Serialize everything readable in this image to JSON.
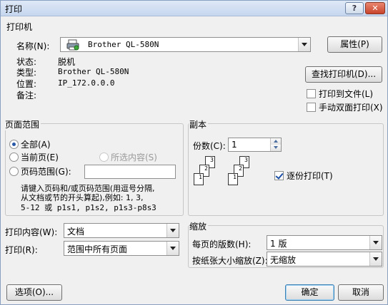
{
  "window": {
    "title": "打印",
    "help_label": "?",
    "close_label": "✕"
  },
  "printer": {
    "section_title": "打印机",
    "name_label": "名称(N):",
    "name_value": "Brother QL-580N",
    "status_label": "状态:",
    "status_value": "脱机",
    "type_label": "类型:",
    "type_value": "Brother QL-580N",
    "location_label": "位置:",
    "location_value": "IP_172.0.0.0",
    "comment_label": "备注:",
    "properties_button": "属性(P)",
    "find_printer_button": "查找打印机(D)...",
    "print_to_file_label": "打印到文件(L)",
    "print_to_file_checked": false,
    "manual_duplex_label": "手动双面打印(X)",
    "manual_duplex_checked": false,
    "printer_icon": "printer-icon"
  },
  "page_range": {
    "section_title": "页面范围",
    "all_label": "全部(A)",
    "current_page_label": "当前页(E)",
    "selection_label": "所选内容(S)",
    "pages_label": "页码范围(G):",
    "pages_value": "",
    "hint_line1": "请键入页码和/或页码范围(用逗号分隔,",
    "hint_line2": "从文档或节的开头算起),例如: 1, 3,",
    "hint_line3": "5-12 或 p1s1, p1s2, p1s3-p8s3",
    "selected": "all"
  },
  "copies": {
    "section_title": "副本",
    "count_label": "份数(C):",
    "count_value": "1",
    "collate_label": "逐份打印(T)",
    "collate_checked": true,
    "stack_pages": [
      "3",
      "2",
      "1"
    ]
  },
  "print_what": {
    "label": "打印内容(W):",
    "value": "文档"
  },
  "print": {
    "label": "打印(R):",
    "value": "范围中所有页面"
  },
  "zoom": {
    "section_title": "缩放",
    "pages_per_sheet_label": "每页的版数(H):",
    "pages_per_sheet_value": "1 版",
    "scale_label": "按纸张大小缩放(Z):",
    "scale_value": "无缩放"
  },
  "footer": {
    "options_button": "选项(O)...",
    "ok_button": "确定",
    "cancel_button": "取消"
  }
}
